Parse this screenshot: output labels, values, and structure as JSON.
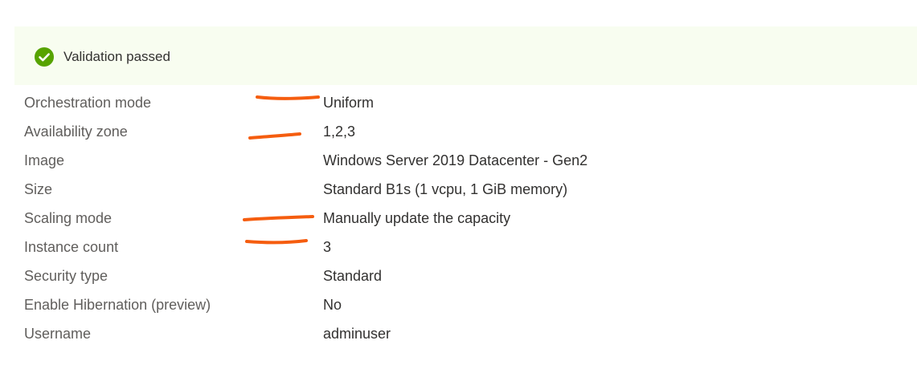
{
  "banner": {
    "icon": "check-circle-icon",
    "icon_color": "#57a300",
    "background": "#f8fdf0",
    "text": "Validation passed"
  },
  "properties": [
    {
      "label": "Orchestration mode",
      "value": "Uniform"
    },
    {
      "label": "Availability zone",
      "value": "1,2,3"
    },
    {
      "label": "Image",
      "value": "Windows Server 2019 Datacenter - Gen2"
    },
    {
      "label": "Size",
      "value": "Standard B1s (1 vcpu, 1 GiB memory)"
    },
    {
      "label": "Scaling mode",
      "value": "Manually update the capacity"
    },
    {
      "label": "Instance count",
      "value": "3"
    },
    {
      "label": "Security type",
      "value": "Standard"
    },
    {
      "label": "Enable Hibernation (preview)",
      "value": "No"
    },
    {
      "label": "Username",
      "value": "adminuser"
    }
  ],
  "annotations": {
    "color": "#f55d0f",
    "marked_rows": [
      "Orchestration mode",
      "Availability zone",
      "Scaling mode",
      "Instance count"
    ]
  }
}
